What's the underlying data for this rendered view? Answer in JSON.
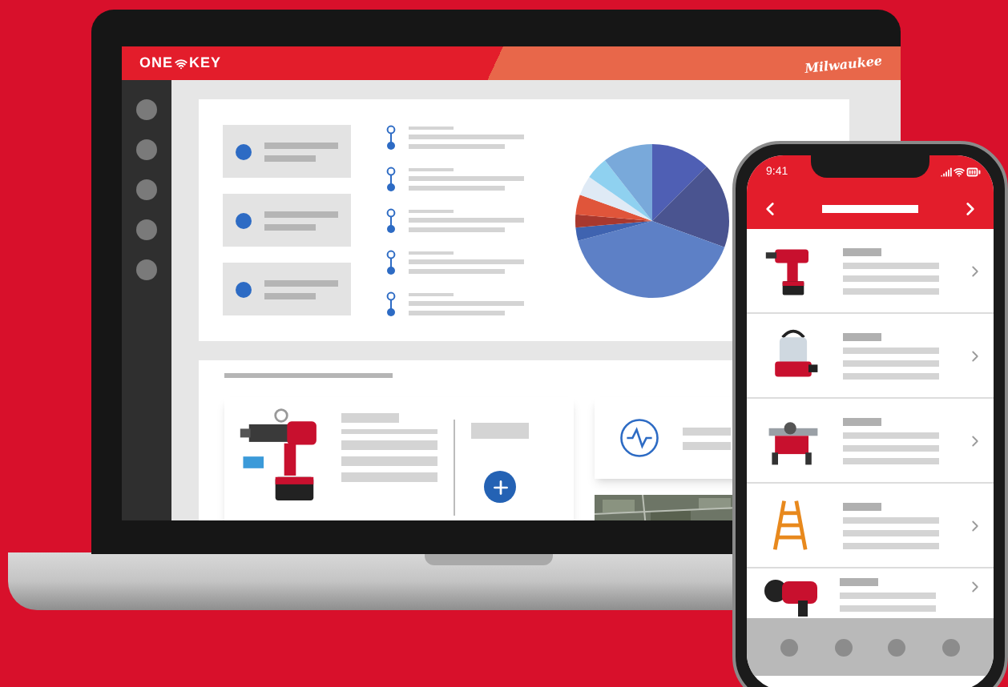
{
  "laptop": {
    "header": {
      "logo_left": "ONE",
      "logo_right": "KEY",
      "brand": "Milwaukee"
    },
    "summary_cards": [
      {
        "kind": "stat"
      },
      {
        "kind": "stat"
      },
      {
        "kind": "stat"
      }
    ],
    "timeline": [
      {
        "kind": "event"
      },
      {
        "kind": "event"
      },
      {
        "kind": "event"
      },
      {
        "kind": "event"
      },
      {
        "kind": "event"
      }
    ]
  },
  "phone": {
    "status_bar": {
      "time": "9:41"
    },
    "rows": [
      {
        "kind": "drill"
      },
      {
        "kind": "lantern"
      },
      {
        "kind": "saw"
      },
      {
        "kind": "ladder"
      },
      {
        "kind": "cutter"
      }
    ]
  }
}
